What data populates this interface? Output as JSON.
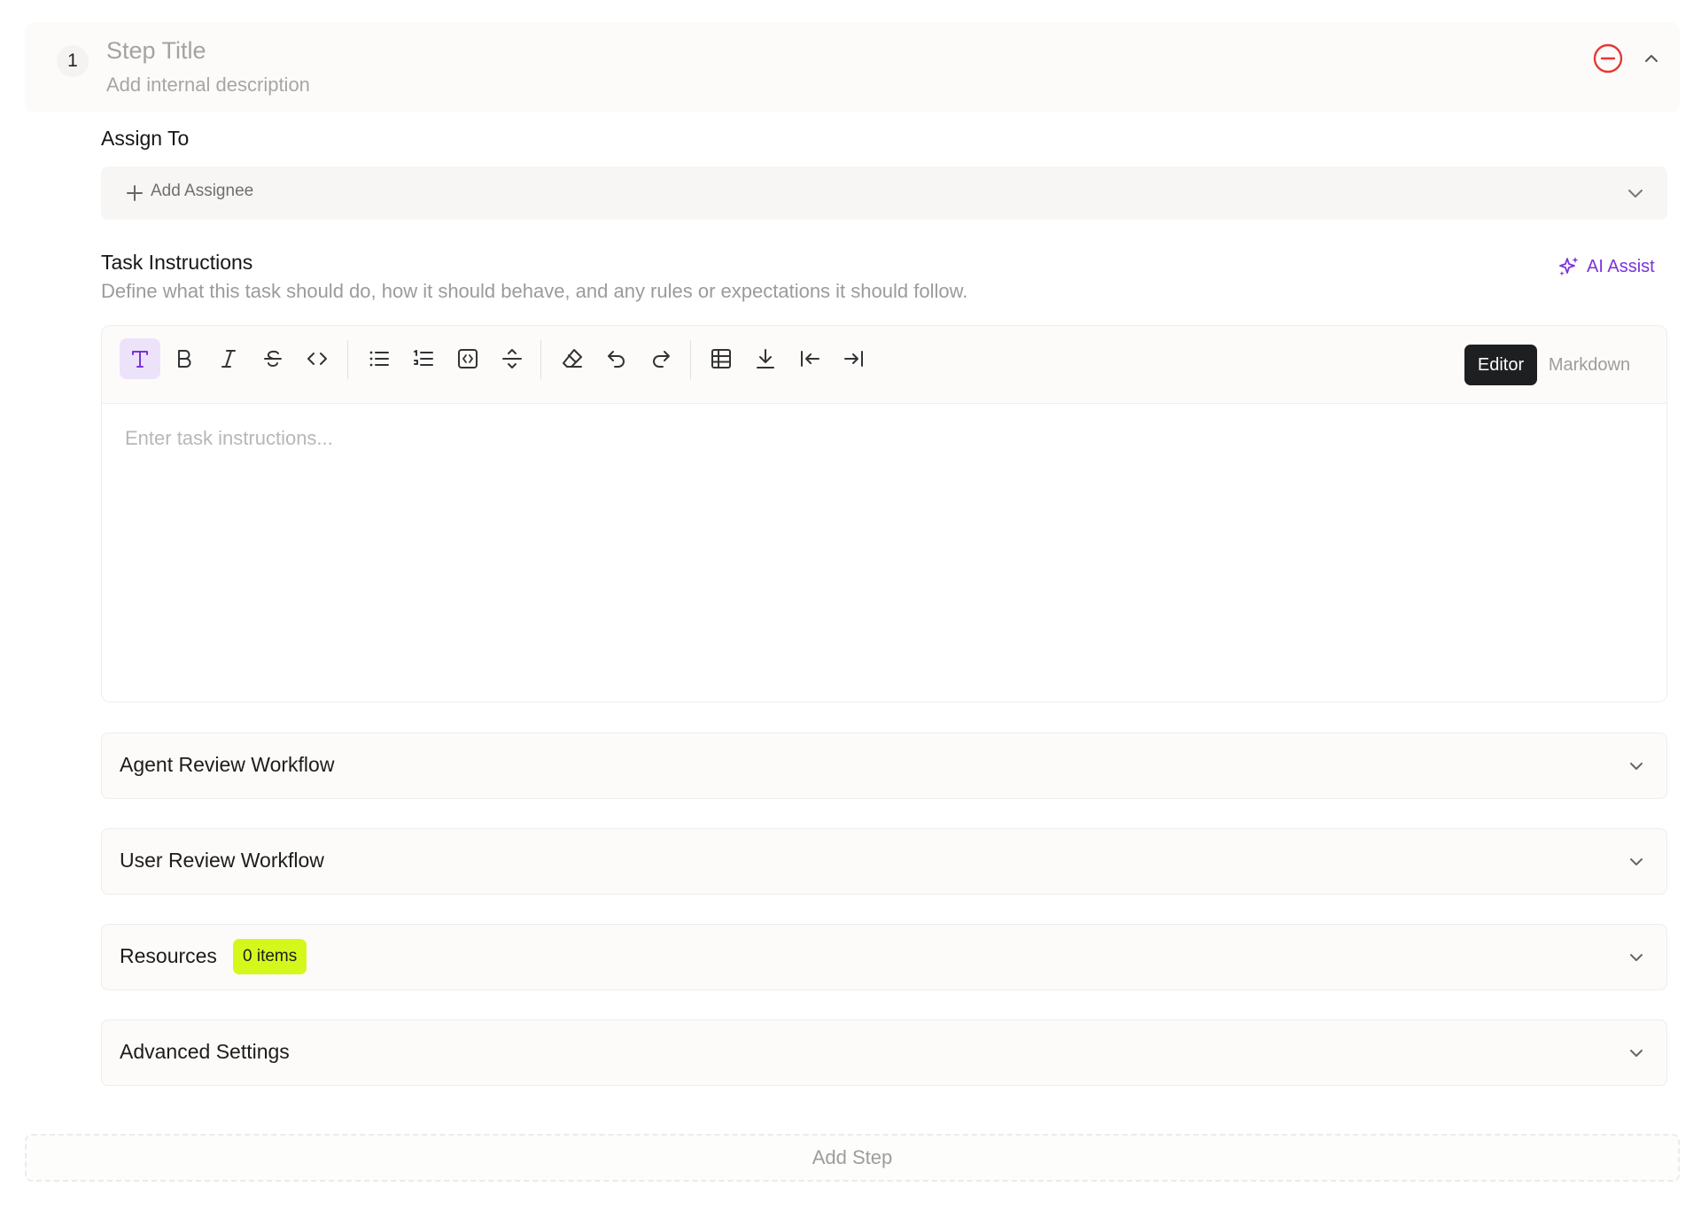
{
  "step": {
    "number": "1",
    "title_placeholder": "Step Title",
    "description_placeholder": "Add internal description"
  },
  "assign": {
    "label": "Assign To",
    "add_label": "Add Assignee"
  },
  "instructions": {
    "label": "Task Instructions",
    "help": "Define what this task should do, how it should behave, and any rules or expectations it should follow.",
    "ai_assist": "AI Assist",
    "placeholder": "Enter task instructions..."
  },
  "toolbar": {
    "tools": [
      "text-icon",
      "bold-icon",
      "italic-icon",
      "strikethrough-icon",
      "code-icon",
      "bullet-list-icon",
      "ordered-list-icon",
      "code-block-icon",
      "horizontal-rule-icon",
      "eraser-icon",
      "undo-icon",
      "redo-icon",
      "table-icon",
      "download-icon",
      "outdent-icon",
      "indent-icon"
    ],
    "mode_editor": "Editor",
    "mode_markdown": "Markdown"
  },
  "sections": {
    "agent_review": "Agent Review Workflow",
    "user_review": "User Review Workflow",
    "resources": "Resources",
    "resources_badge": "0 items",
    "advanced": "Advanced Settings"
  },
  "add_step": "Add Step",
  "colors": {
    "accent": "#7a33d9",
    "danger": "#e53935",
    "badge": "#d5f81c",
    "dark": "#1d1f20"
  }
}
